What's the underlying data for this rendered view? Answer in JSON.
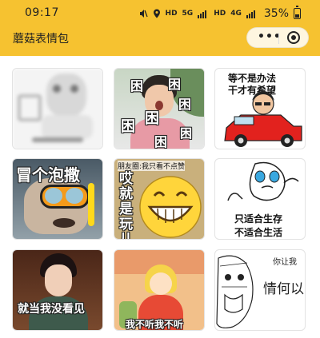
{
  "status_bar": {
    "time": "09:17",
    "network": "HD",
    "signal": "5G",
    "hd2": "HD",
    "signal2": "4G",
    "battery": "35%"
  },
  "header": {
    "title": "蘑菇表情包",
    "more_icon": "more-dots-icon",
    "close_icon": "target-close-icon"
  },
  "stickers": [
    {
      "caption": "",
      "blurred": true
    },
    {
      "caption": "困"
    },
    {
      "caption_line1": "等不是办法",
      "caption_line2": "干才有希望"
    },
    {
      "caption": "冒个泡撒"
    },
    {
      "caption_top": "朋友圈:我只看不点赞",
      "caption_side": "哎就是玩儿"
    },
    {
      "caption_line1": "只适合生存",
      "caption_line2": "不适合生活"
    },
    {
      "caption": "就当我没看见"
    },
    {
      "caption": "我不听我不听"
    },
    {
      "caption_top": "你让我",
      "caption_main": "情何以"
    }
  ]
}
